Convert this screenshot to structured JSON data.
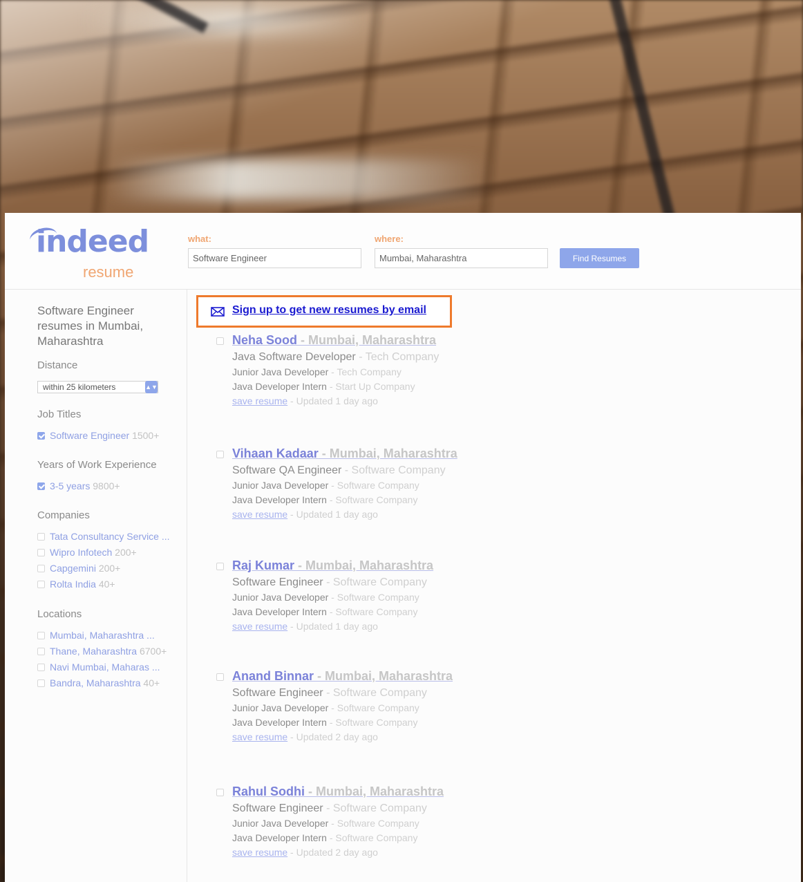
{
  "header": {
    "logo_main": "indeed",
    "logo_sub": "resume",
    "what_label": "what:",
    "what_value": "Software Engineer",
    "where_label": "where:",
    "where_value": "Mumbai, Maharashtra",
    "find_button": "Find Resumes"
  },
  "sidebar": {
    "title": "Software Engineer resumes in Mumbai, Maharashtra",
    "distance_heading": "Distance",
    "distance_value": "within 25 kilometers",
    "job_titles_heading": "Job Titles",
    "job_titles": [
      {
        "label": "Software Engineer",
        "count": "1500+",
        "checked": true
      }
    ],
    "experience_heading": "Years of Work Experience",
    "experience": [
      {
        "label": "3-5 years",
        "count": "9800+",
        "checked": true
      }
    ],
    "companies_heading": "Companies",
    "companies": [
      {
        "label": "Tata Consultancy Service ...",
        "count": ""
      },
      {
        "label": "Wipro Infotech",
        "count": "200+"
      },
      {
        "label": "Capgemini",
        "count": "200+"
      },
      {
        "label": "Rolta India",
        "count": "40+"
      }
    ],
    "locations_heading": "Locations",
    "locations": [
      {
        "label": "Mumbai, Maharashtra ...",
        "count": ""
      },
      {
        "label": "Thane, Maharashtra",
        "count": "6700+"
      },
      {
        "label": "Navi Mumbai, Maharas ...",
        "count": ""
      },
      {
        "label": "Bandra, Maharashtra",
        "count": "40+"
      }
    ]
  },
  "signup": {
    "label": "Sign up to get new resumes by email",
    "icon": "envelope-icon",
    "border_color": "#ee7a2c"
  },
  "results": [
    {
      "name": "Neha Sood",
      "location": " - Mumbai, Maharashtra",
      "role": "Java Software Developer",
      "role_company": " - Tech Company",
      "job2": "Junior Java Developer",
      "job2_company": " - Tech Company",
      "job3": "Java Developer Intern",
      "job3_company": " - Start Up Company",
      "save": "save resume",
      "updated": " - Updated 1 day ago"
    },
    {
      "name": "Vihaan Kadaar",
      "location": " - Mumbai, Maharashtra",
      "role": "Software QA Engineer",
      "role_company": " - Software Company",
      "job2": "Junior Java Developer",
      "job2_company": " - Software Company",
      "job3": "Java Developer Intern",
      "job3_company": " - Software Company",
      "save": "save resume",
      "updated": " - Updated 1 day ago"
    },
    {
      "name": "Raj Kumar",
      "location": " - Mumbai, Maharashtra",
      "role": "Software Engineer",
      "role_company": " - Software Company",
      "job2": "Junior Java Developer",
      "job2_company": " - Software Company",
      "job3": "Java Developer Intern",
      "job3_company": " - Software Company",
      "save": "save resume",
      "updated": " - Updated 1 day ago"
    },
    {
      "name": "Anand Binnar",
      "location": " - Mumbai, Maharashtra",
      "role": "Software Engineer",
      "role_company": " - Software Company",
      "job2": "Junior Java Developer",
      "job2_company": " - Software Company",
      "job3": "Java Developer Intern",
      "job3_company": " - Software Company",
      "save": "save resume",
      "updated": " - Updated 2 day ago"
    },
    {
      "name": "Rahul Sodhi",
      "location": " - Mumbai, Maharashtra",
      "role": "Software Engineer",
      "role_company": " - Software Company",
      "job2": "Junior Java Developer",
      "job2_company": " - Software Company",
      "job3": "Java Developer Intern",
      "job3_company": " - Software Company",
      "save": "save resume",
      "updated": " - Updated 2 day ago"
    }
  ]
}
